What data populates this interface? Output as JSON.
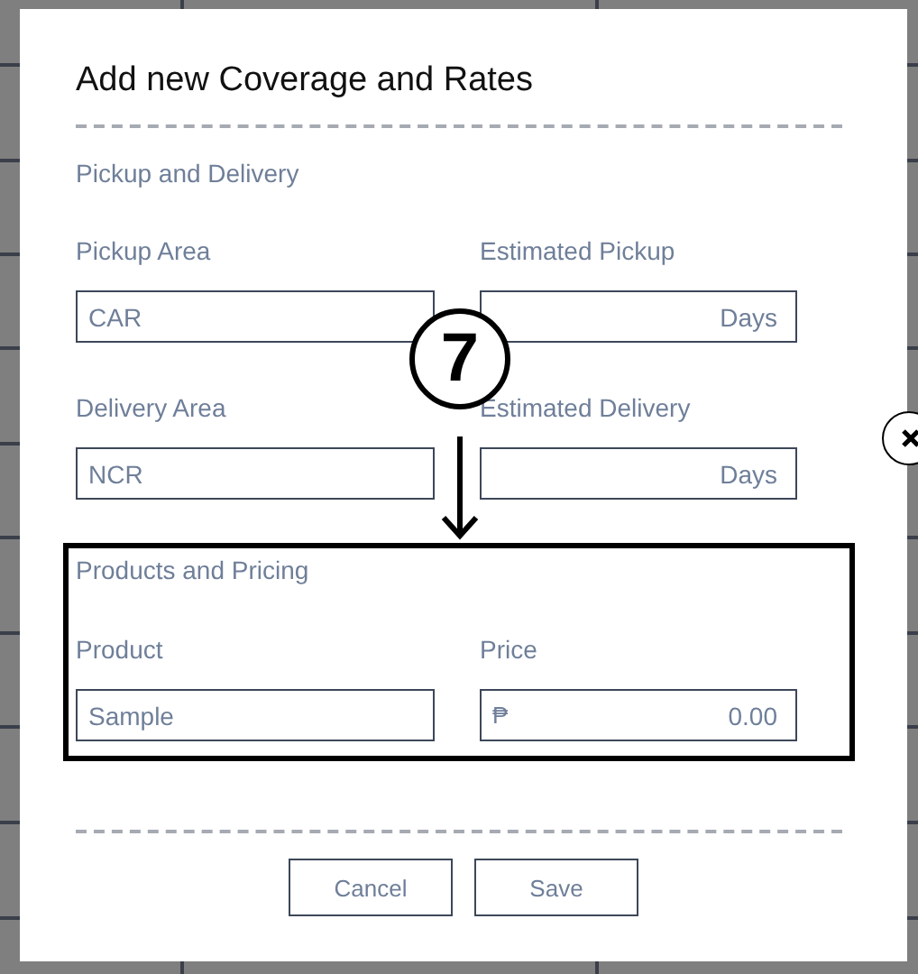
{
  "dialog": {
    "title": "Add new Coverage and Rates",
    "sections": [
      {
        "title": "Pickup and Delivery",
        "highlighted": false,
        "rows": [
          {
            "left": {
              "label": "Pickup Area",
              "value": "CAR"
            },
            "right": {
              "label": "Estimated Pickup",
              "suffix": "Days"
            }
          },
          {
            "left": {
              "label": "Delivery Area",
              "value": "NCR"
            },
            "right": {
              "label": "Estimated Delivery",
              "suffix": "Days"
            }
          }
        ]
      },
      {
        "title": "Products and Pricing",
        "highlighted": true,
        "rows": [
          {
            "left": {
              "label": "Product",
              "value": "Sample"
            },
            "right": {
              "label": "Price",
              "prefix": "₱",
              "value": "0.00"
            }
          }
        ]
      }
    ],
    "buttons": [
      "Cancel",
      "Save"
    ]
  },
  "annotation": {
    "label": "7"
  }
}
